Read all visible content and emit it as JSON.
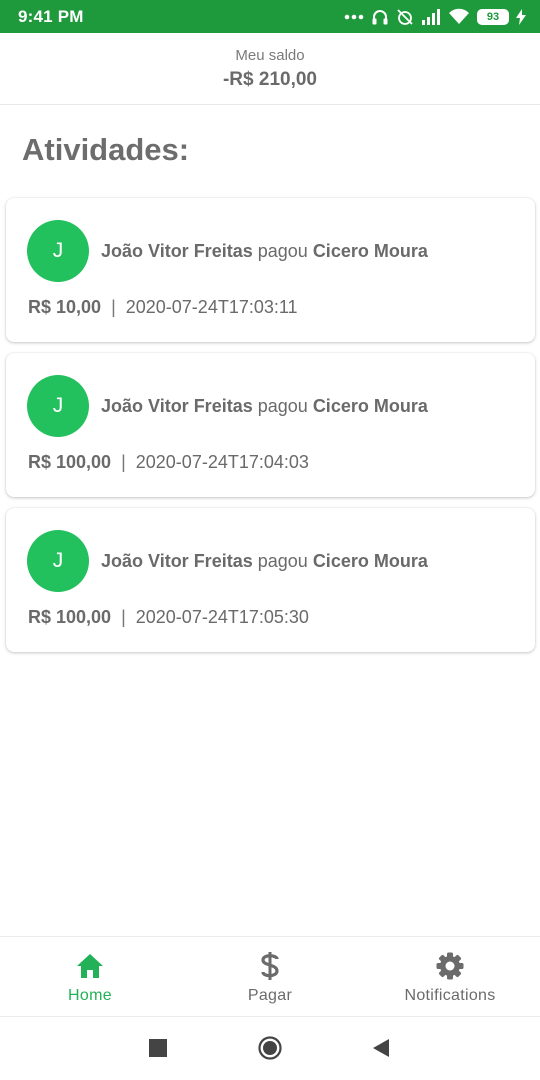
{
  "status_bar": {
    "time": "9:41 PM",
    "battery": "93"
  },
  "header": {
    "label": "Meu saldo",
    "balance": "-R$ 210,00"
  },
  "section_title": "Atividades:",
  "activities": [
    {
      "avatar": "J",
      "payer": "João Vitor Freitas",
      "verb": "pagou",
      "payee": "Cicero Moura",
      "amount": "R$ 10,00",
      "separator": "|",
      "timestamp": "2020-07-24T17:03:11"
    },
    {
      "avatar": "J",
      "payer": "João Vitor Freitas",
      "verb": "pagou",
      "payee": "Cicero Moura",
      "amount": "R$ 100,00",
      "separator": "|",
      "timestamp": "2020-07-24T17:04:03"
    },
    {
      "avatar": "J",
      "payer": "João Vitor Freitas",
      "verb": "pagou",
      "payee": "Cicero Moura",
      "amount": "R$ 100,00",
      "separator": "|",
      "timestamp": "2020-07-24T17:05:30"
    }
  ],
  "bottom_nav": {
    "tabs": [
      {
        "label": "Home",
        "icon": "home-icon",
        "active": true
      },
      {
        "label": "Pagar",
        "icon": "dollar-icon",
        "active": false
      },
      {
        "label": "Notifications",
        "icon": "gear-icon",
        "active": false
      }
    ]
  },
  "colors": {
    "status_bar": "#1e9a3c",
    "accent": "#22c15e",
    "active_tab": "#22b157",
    "text": "#6b6b6b"
  }
}
